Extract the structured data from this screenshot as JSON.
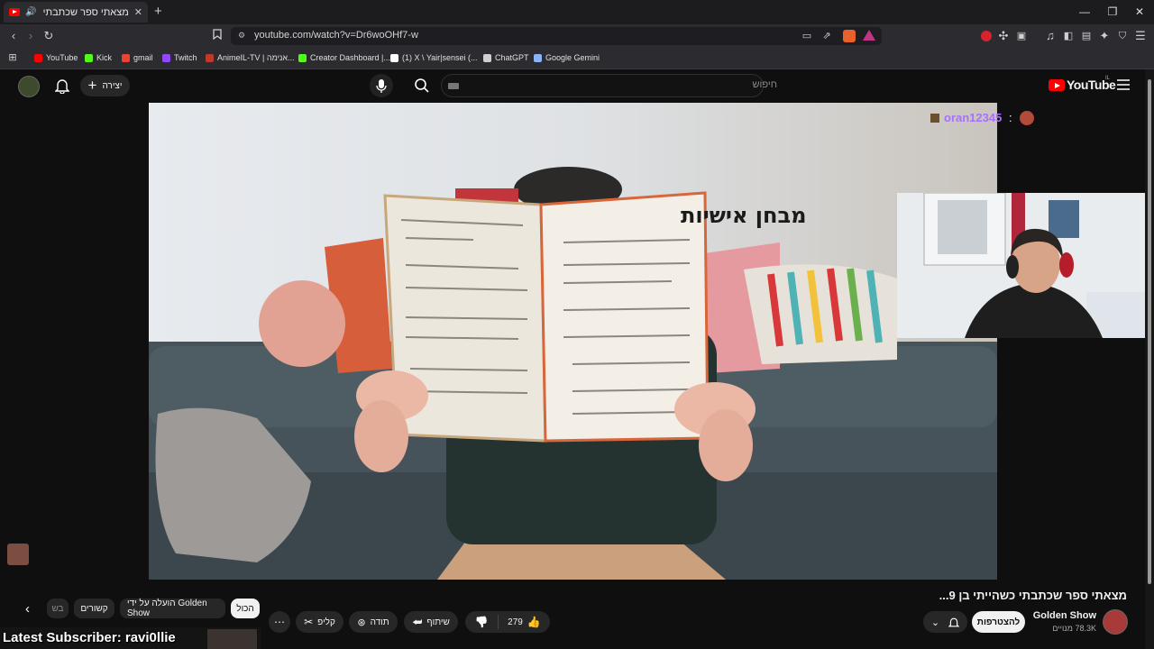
{
  "browser": {
    "tab_title": "מצאתי ספר שכתבתי כשהייתי",
    "new_tab": "+",
    "url": "youtube.com/watch?v=Dr6woOHf7-w",
    "window_controls": {
      "minimize": "—",
      "maximize": "❐",
      "close": "✕"
    },
    "bookmarks": [
      {
        "label": "YouTube",
        "icon": "youtube-icon",
        "color": "#ff0000"
      },
      {
        "label": "Kick",
        "icon": "kick-icon",
        "color": "#53fc18"
      },
      {
        "label": "gmail",
        "icon": "gmail-icon",
        "color": "#ea4335"
      },
      {
        "label": "Twitch",
        "icon": "twitch-icon",
        "color": "#9146ff"
      },
      {
        "label": "AnimeIL-TV | אנימה...",
        "icon": "animeil-icon",
        "color": "#c0392b"
      },
      {
        "label": "Creator Dashboard |...",
        "icon": "kick-icon",
        "color": "#53fc18"
      },
      {
        "label": "(1) X \\ Yair|sensei (...",
        "icon": "x-icon",
        "color": "#ffffff"
      },
      {
        "label": "ChatGPT",
        "icon": "chatgpt-icon",
        "color": "#d0d0d0"
      },
      {
        "label": "Google Gemini",
        "icon": "gemini-icon",
        "color": "#8ab4f8"
      }
    ]
  },
  "youtube": {
    "logo_text": "YouTube",
    "logo_sup": "IL",
    "search_placeholder": "חיפוש",
    "create_label": "יצירה",
    "accent": "#ff0000"
  },
  "video": {
    "book_title": "מבחן אישיות",
    "chat_user": "oran12345",
    "chat_sep": ":",
    "title": "מצאתי ספר שכתבתי כשהייתי בן 9...",
    "channel": "Golden Show",
    "subscribers": "78.3K מנויים",
    "join_label": "להצטרפות",
    "likes": "279",
    "share_label": "שיתוף",
    "thanks_label": "תודה",
    "clip_label": "קליפ",
    "more_label": "⋯"
  },
  "chips": [
    {
      "label": "הכול",
      "active": true
    },
    {
      "label": "הועלה על ידי Golden Show",
      "active": false
    },
    {
      "label": "קשורים",
      "active": false
    },
    {
      "label": "בש",
      "active": false
    }
  ],
  "overlay": {
    "latest_subscriber": "Latest Subscriber: ravi0llie"
  }
}
